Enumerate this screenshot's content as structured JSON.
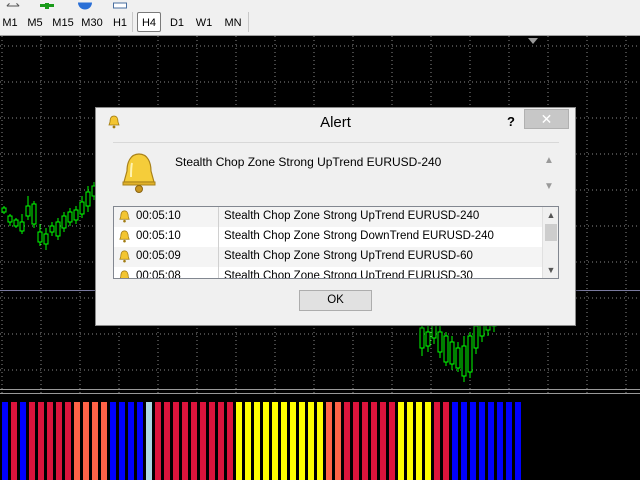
{
  "toolbar": {
    "timeframes": [
      {
        "label": "M1",
        "active": false
      },
      {
        "label": "M5",
        "active": false
      },
      {
        "label": "M15",
        "active": false
      },
      {
        "label": "M30",
        "active": false
      },
      {
        "label": "H1",
        "active": false
      },
      {
        "label": "H4",
        "active": true
      },
      {
        "label": "D1",
        "active": false
      },
      {
        "label": "W1",
        "active": false
      },
      {
        "label": "MN",
        "active": false
      }
    ]
  },
  "dialog": {
    "title": "Alert",
    "help_label": "?",
    "close_label": "✕",
    "message": "Stealth Chop Zone Strong UpTrend EURUSD-240",
    "ok_label": "OK",
    "rows": [
      {
        "time": "00:05:10",
        "text": "Stealth Chop Zone Strong UpTrend EURUSD-240"
      },
      {
        "time": "00:05:10",
        "text": "Stealth Chop Zone Strong DownTrend EURUSD-240"
      },
      {
        "time": "00:05:09",
        "text": "Stealth Chop Zone Strong UpTrend EURUSD-60"
      },
      {
        "time": "00:05:08",
        "text": "Stealth Chop Zone Strong UpTrend EURUSD-30"
      }
    ]
  },
  "colors": {
    "bull_candle": "#00ff00",
    "bear_candle": "#00ff00",
    "strong_down": "#dc143c",
    "weak_down": "#ff6347",
    "strong_up": "#0000ff",
    "weak_up": "#add8e6",
    "neutral": "#ffff00"
  },
  "chop_zone": [
    "#0000ff",
    "#dc143c",
    "#0000ff",
    "#dc143c",
    "#dc143c",
    "#dc143c",
    "#dc143c",
    "#dc143c",
    "#ff6347",
    "#ff6347",
    "#ff6347",
    "#ff6347",
    "#0000ff",
    "#0000ff",
    "#0000ff",
    "#0000ff",
    "#add8e6",
    "#dc143c",
    "#dc143c",
    "#dc143c",
    "#dc143c",
    "#dc143c",
    "#dc143c",
    "#dc143c",
    "#dc143c",
    "#dc143c",
    "#ffff00",
    "#ffff00",
    "#ffff00",
    "#ffff00",
    "#ffff00",
    "#ffff00",
    "#ffff00",
    "#ffff00",
    "#ffff00",
    "#ffff00",
    "#ff6347",
    "#ff6347",
    "#dc143c",
    "#dc143c",
    "#dc143c",
    "#dc143c",
    "#dc143c",
    "#dc143c",
    "#ffff00",
    "#ffff00",
    "#ffff00",
    "#ffff00",
    "#dc143c",
    "#dc143c",
    "#0000ff",
    "#0000ff",
    "#0000ff",
    "#0000ff",
    "#0000ff",
    "#0000ff",
    "#0000ff",
    "#0000ff"
  ]
}
